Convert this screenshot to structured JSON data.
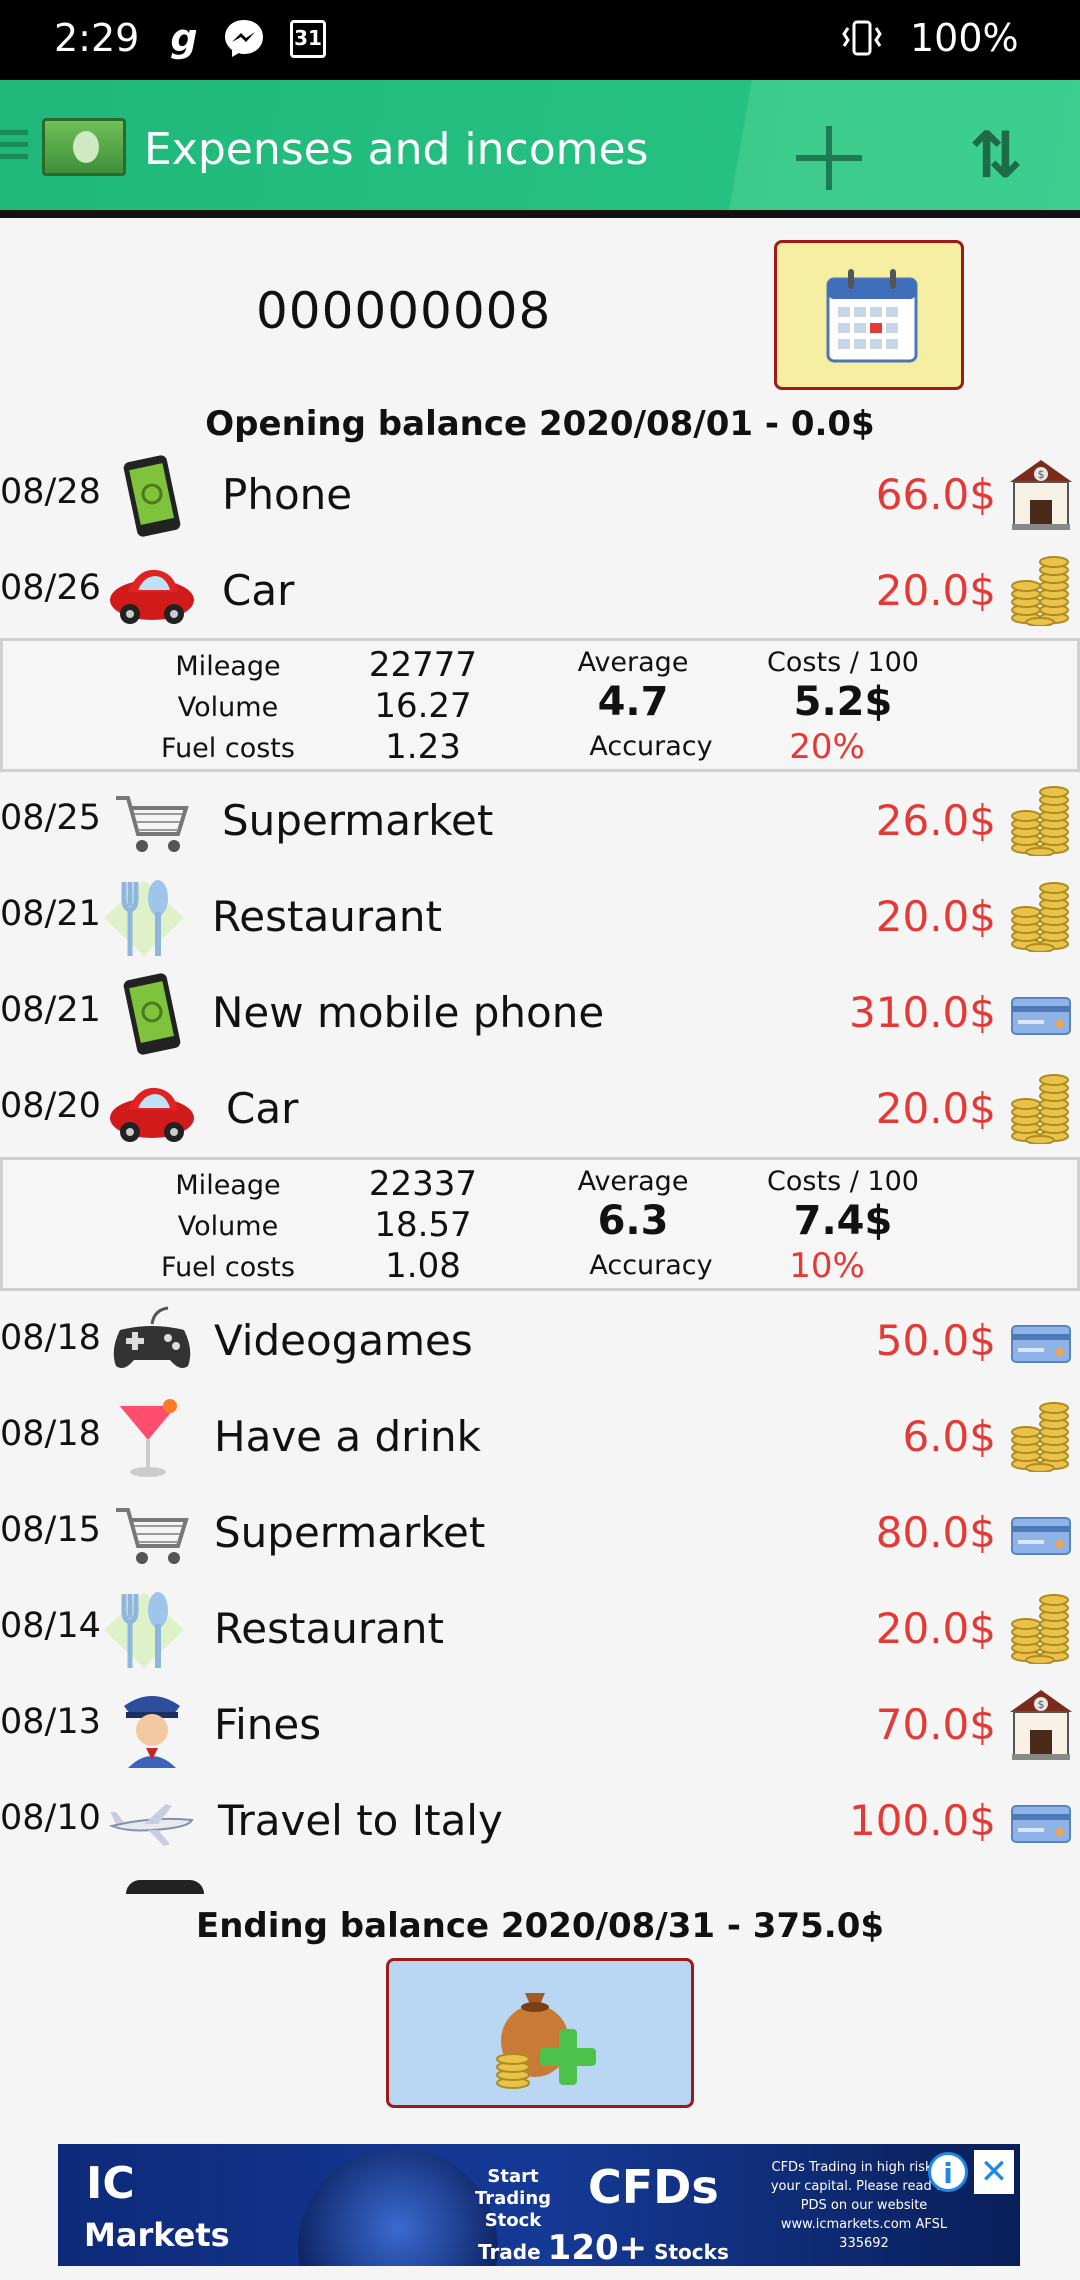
{
  "status_bar": {
    "time": "2:29",
    "battery": "100%",
    "cal_day": "31",
    "icons": [
      "g-icon",
      "messenger-icon",
      "calendar-icon",
      "vibrate-icon"
    ]
  },
  "app_bar": {
    "title": "Expenses and incomes",
    "icons": [
      "menu-icon",
      "money-logo-icon",
      "add-icon",
      "sort-icon"
    ]
  },
  "header": {
    "account_number": "000000008",
    "opening_balance": "Opening balance  2020/08/01 - 0.0$"
  },
  "entries": [
    {
      "date": "08/28",
      "label": "Phone",
      "amount": "66.0$",
      "category_icon": "phone-icon",
      "payment_icon": "bank-icon"
    },
    {
      "date": "08/26",
      "label": "Car",
      "amount": "20.0$",
      "category_icon": "car-icon",
      "payment_icon": "coins-icon"
    },
    {
      "date": "08/25",
      "label": "Supermarket",
      "amount": "26.0$",
      "category_icon": "cart-icon",
      "payment_icon": "coins-icon"
    },
    {
      "date": "08/21",
      "label": "Restaurant",
      "amount": "20.0$",
      "category_icon": "cutlery-icon",
      "payment_icon": "coins-icon"
    },
    {
      "date": "08/21",
      "label": "New mobile phone",
      "amount": "310.0$",
      "category_icon": "phone-icon",
      "payment_icon": "credit-card-icon"
    },
    {
      "date": "08/20",
      "label": "Car",
      "amount": "20.0$",
      "category_icon": "car-icon",
      "payment_icon": "coins-icon"
    },
    {
      "date": "08/18",
      "label": "Videogames",
      "amount": "50.0$",
      "category_icon": "gamepad-icon",
      "payment_icon": "credit-card-icon"
    },
    {
      "date": "08/18",
      "label": "Have a drink",
      "amount": "6.0$",
      "category_icon": "cocktail-icon",
      "payment_icon": "coins-icon"
    },
    {
      "date": "08/15",
      "label": "Supermarket",
      "amount": "80.0$",
      "category_icon": "cart-icon",
      "payment_icon": "credit-card-icon"
    },
    {
      "date": "08/14",
      "label": "Restaurant",
      "amount": "20.0$",
      "category_icon": "cutlery-icon",
      "payment_icon": "coins-icon"
    },
    {
      "date": "08/13",
      "label": "Fines",
      "amount": "70.0$",
      "category_icon": "police-icon",
      "payment_icon": "bank-icon"
    },
    {
      "date": "08/10",
      "label": "Travel to Italy",
      "amount": "100.0$",
      "category_icon": "airplane-icon",
      "payment_icon": "credit-card-icon"
    }
  ],
  "fuel_labels": {
    "mileage": "Mileage",
    "volume": "Volume",
    "fuel_costs": "Fuel costs",
    "average": "Average",
    "accuracy": "Accuracy",
    "costs_per_100": "Costs / 100"
  },
  "fuel_stats": [
    {
      "mileage": "22777",
      "volume": "16.27",
      "fuel_costs": "1.23",
      "average": "4.7",
      "costs_per_100": "5.2$",
      "accuracy": "20%"
    },
    {
      "mileage": "22337",
      "volume": "18.57",
      "fuel_costs": "1.08",
      "average": "6.3",
      "costs_per_100": "7.4$",
      "accuracy": "10%"
    }
  ],
  "footer": {
    "ending_balance": "Ending balance  2020/08/31 - 375.0$"
  },
  "ad": {
    "brand_top": "IC",
    "brand_bottom": "Markets",
    "start_trading": "Start Trading Stock",
    "cfds": "CFDs",
    "trade": "Trade",
    "trade_count": "120+",
    "stocks": "Stocks",
    "disclaimer": "CFDs Trading in high risks to your capital. Please read the PDS on our website www.icmarkets.com AFSL 335692",
    "info": "i",
    "close": "✕"
  },
  "colors": {
    "accent_green": "#25c183",
    "amount_red": "#e53935",
    "button_border": "#a01a1a"
  }
}
